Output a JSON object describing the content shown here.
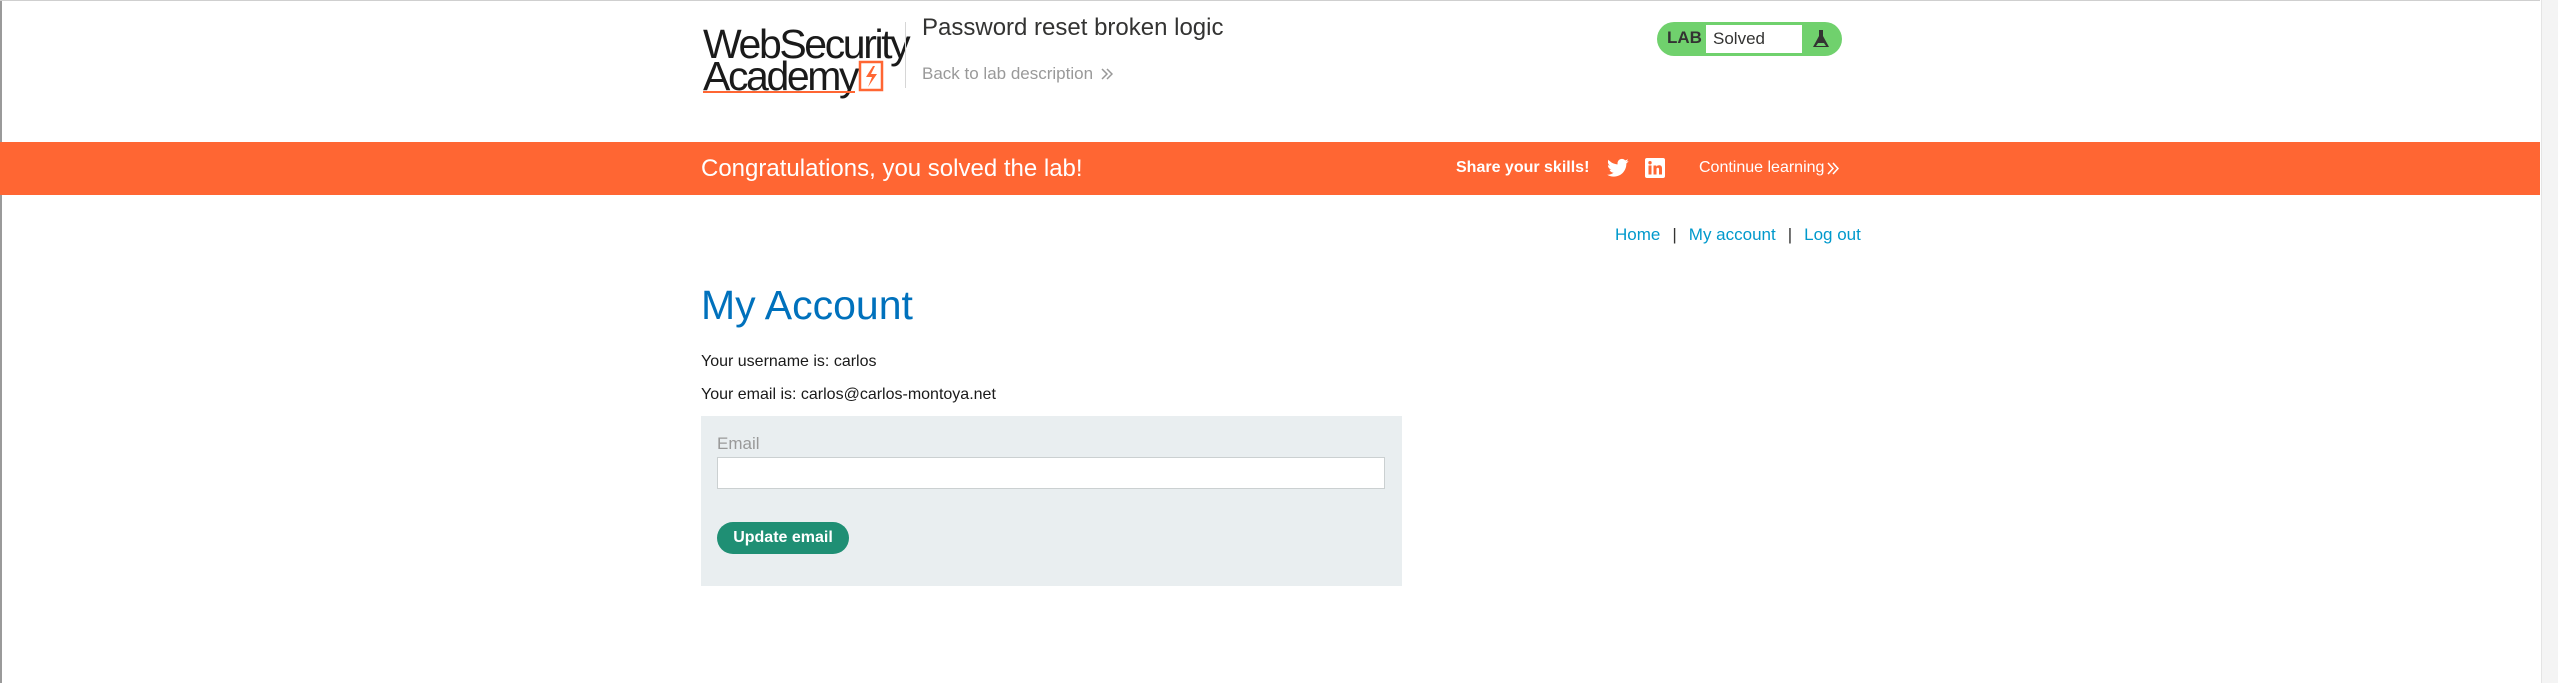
{
  "header": {
    "logo": {
      "line1": "WebSecurity",
      "line2": "Academy",
      "mark_icon": "academy-bolt-icon"
    },
    "lab_title": "Password reset broken logic",
    "back_link": "Back to lab description",
    "lab_status": {
      "label": "LAB",
      "value": "Solved",
      "icon": "flask-icon"
    }
  },
  "banner": {
    "message": "Congratulations, you solved the lab!",
    "share_label": "Share your skills!",
    "share_icons": [
      "twitter-icon",
      "linkedin-icon"
    ],
    "continue_link": "Continue learning"
  },
  "nav": {
    "home": "Home",
    "separator": "|",
    "my_account": "My account",
    "log_out": "Log out"
  },
  "account": {
    "heading": "My Account",
    "username_line": "Your username is: carlos",
    "email_line": "Your email is: carlos@carlos-montoya.net"
  },
  "form": {
    "email_label": "Email",
    "email_value": "",
    "update_button": "Update email"
  },
  "colors": {
    "brand_orange": "#ff6633",
    "solved_green": "#70d16d",
    "link_blue": "#0099cc",
    "heading_blue": "#0071bc",
    "button_green": "#1f8f74",
    "panel_bg": "#e9eef0"
  }
}
